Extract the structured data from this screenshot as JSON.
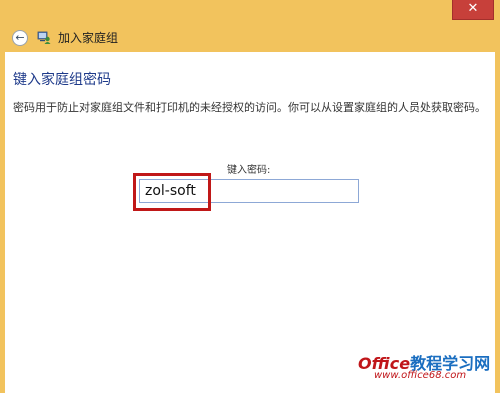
{
  "window": {
    "title": "加入家庭组",
    "close_glyph": "✕",
    "back_glyph": "←",
    "back_icon": "back-arrow-icon",
    "homegroup_icon": "homegroup-icon"
  },
  "main": {
    "heading": "键入家庭组密码",
    "description": "密码用于防止对家庭组文件和打印机的未经授权的访问。你可以从设置家庭组的人员处获取密码。",
    "password_label": "键入密码:",
    "password_value": "zol-soft"
  },
  "watermark": {
    "brand_latin": "Office",
    "brand_cn": "教程学习网",
    "url": "www.office68.com"
  },
  "colors": {
    "frame": "#f2c35d",
    "heading": "#1e3a8a",
    "highlight": "#c01818",
    "close_button": "#c7403a"
  }
}
